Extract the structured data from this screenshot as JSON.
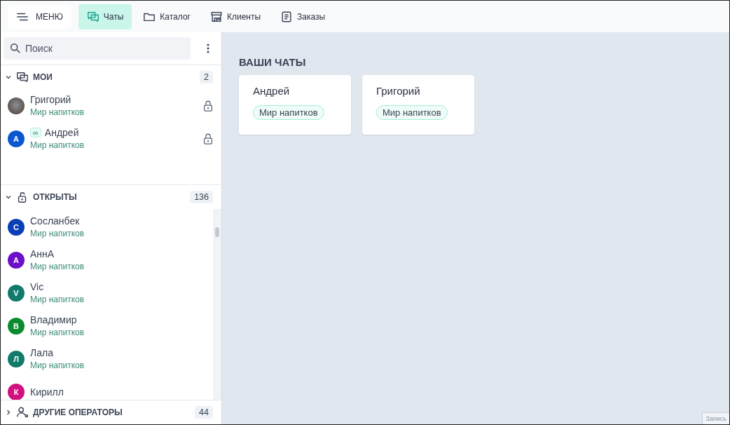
{
  "menu_button": {
    "label": "МЕНЮ"
  },
  "nav": [
    {
      "label": "Чаты",
      "selected": true
    },
    {
      "label": "Каталог",
      "selected": false
    },
    {
      "label": "Клиенты",
      "selected": false
    },
    {
      "label": "Заказы",
      "selected": false
    }
  ],
  "search": {
    "placeholder": "Поиск"
  },
  "sections": [
    {
      "title": "МОИ",
      "count": "2",
      "expanded": true,
      "items": [
        {
          "name": "Григорий",
          "subtitle": "Мир напитков",
          "locked": true
        },
        {
          "badge": "∞",
          "name": "Андрей",
          "subtitle": "Мир напитков",
          "letter": "А",
          "color": "#0b57d0",
          "locked": true
        }
      ]
    },
    {
      "title": "ОТКРЫТЫ",
      "count": "136",
      "expanded": true,
      "items": [
        {
          "name": "Сосланбек",
          "subtitle": "Мир напитков",
          "letter": "С",
          "color": "#0a3fb5",
          "locked": false
        },
        {
          "name": "АннА",
          "subtitle": "Мир напитков",
          "letter": "А",
          "color": "#6c0fc9",
          "locked": false
        },
        {
          "name": "Vic",
          "subtitle": "Мир напитков",
          "letter": "V",
          "color": "#127a6b",
          "locked": false
        },
        {
          "name": "Владимир",
          "subtitle": "Мир напитков",
          "letter": "В",
          "color": "#0b8a2f",
          "locked": false
        },
        {
          "name": "Лала",
          "subtitle": "Мир напитков",
          "letter": "Л",
          "color": "#127a6b",
          "locked": false
        },
        {
          "name": "Кирилл",
          "letter": "К",
          "color": "#d1117f",
          "locked": false
        }
      ]
    },
    {
      "title": "ДРУГИЕ ОПЕРАТОРЫ",
      "count": "44",
      "expanded": false
    }
  ],
  "main": {
    "heading": "ВАШИ ЧАТЫ",
    "cards": [
      {
        "name": "Андрей",
        "tag": "Мир напитков"
      },
      {
        "name": "Григорий",
        "tag": "Мир напитков"
      }
    ]
  },
  "corner_tab": {
    "label": "Запись"
  }
}
